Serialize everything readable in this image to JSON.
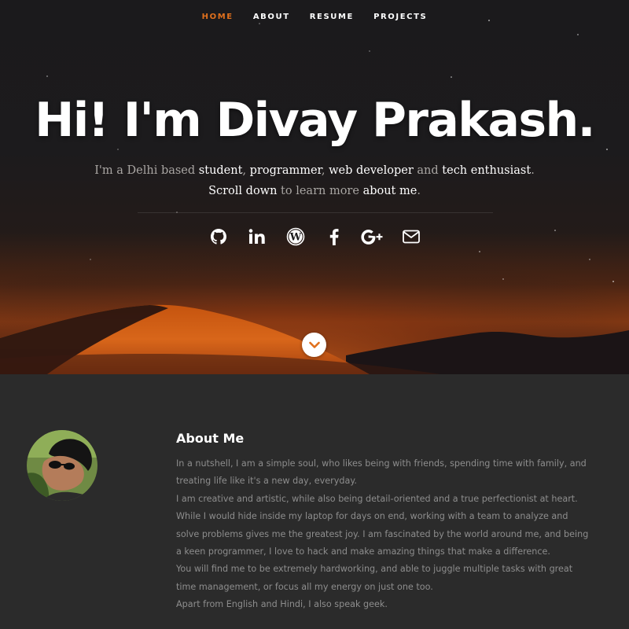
{
  "nav": {
    "items": [
      "HOME",
      "ABOUT",
      "RESUME",
      "PROJECTS"
    ],
    "active_index": 0,
    "active_color": "#e0701c"
  },
  "hero": {
    "title": "Hi! I'm Divay Prakash.",
    "tagline_line1": {
      "p1": "I'm a Delhi based ",
      "student": "student",
      "s1": ", ",
      "programmer": "programmer",
      "s2": ", ",
      "web_developer": "web developer",
      "s3": " and ",
      "tech_enthusiast": "tech enthusiast",
      "end": "."
    },
    "tagline_line2": {
      "scroll_down": "Scroll down",
      "mid": " to learn more ",
      "about_me": "about me",
      "end": "."
    },
    "social_icons": [
      "github-icon",
      "linkedin-icon",
      "wordpress-icon",
      "facebook-icon",
      "google-plus-icon",
      "email-icon"
    ]
  },
  "about": {
    "title": "About Me",
    "paragraphs": [
      "In a nutshell, I am a simple soul, who likes being with friends, spending time with family, and treating life like it's a new day, everyday.",
      "I am creative and artistic, while also being detail-oriented and a true perfectionist at heart. While I would hide inside my laptop for days on end, working with a team to analyze and solve problems gives me the greatest joy. I am fascinated by the world around me, and being a keen programmer, I love to hack and make amazing things that make a difference.",
      "You will find me to be extremely hardworking, and able to juggle multiple tasks with great time management, or focus all my energy on just one too.",
      "Apart from English and Hindi, I also speak geek."
    ]
  },
  "colors": {
    "accent": "#e0701c",
    "section_bg": "#2b2b2b",
    "body_text": "#8d8d8d"
  }
}
